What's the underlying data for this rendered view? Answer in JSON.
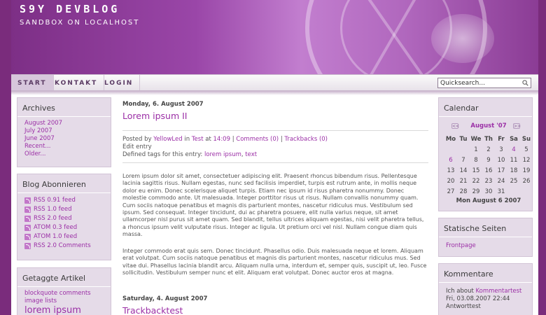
{
  "header": {
    "title": "S9Y DEVBLOG",
    "subtitle": "SANDBOX ON LOCALHOST"
  },
  "nav": {
    "items": [
      "START",
      "KONTAKT",
      "LOGIN"
    ],
    "search_value": "Quicksearch..."
  },
  "left_sidebar": {
    "archives": {
      "title": "Archives",
      "links": [
        "August 2007",
        "July 2007",
        "June 2007",
        "Recent...",
        "Older..."
      ]
    },
    "subscribe": {
      "title": "Blog Abonnieren",
      "feeds": [
        "RSS 0.91 feed",
        "RSS 1.0 feed",
        "RSS 2.0 feed",
        "ATOM 0.3 feed",
        "ATOM 1.0 feed",
        "RSS 2.0 Comments"
      ]
    },
    "tagged": {
      "title": "Getaggte Artikel",
      "links": [
        "blockquote comments",
        "image lists",
        "lorem ipsum"
      ]
    }
  },
  "posts": [
    {
      "date": "Monday, 6. August 2007",
      "title": "Lorem ipsum II",
      "meta": {
        "posted_by": "Posted by",
        "author": "YellowLed",
        "in": "in",
        "category": "Test",
        "at": "at",
        "time": "14:09",
        "comments": "Comments (0)",
        "trackbacks": "Trackbacks (0)",
        "edit": "Edit entry",
        "tags_label": "Defined tags for this entry:",
        "tag1": "lorem ipsum",
        "tag2": "text"
      },
      "body1": "Lorem ipsum dolor sit amet, consectetuer adipiscing elit. Praesent rhoncus bibendum risus. Pellentesque lacinia sagittis risus. Nullam egestas, nunc sed facilisis imperdiet, turpis est rutrum ante, in mollis neque dolor eu enim. Donec scelerisque aliquet turpis. Etiam nec ipsum id risus pharetra nonummy. Donec molestie commodo ante. Ut malesuada. Integer porttitor risus ut risus. Nullam convallis nonummy quam. Cum sociis natoque penatibus et magnis dis parturient montes, nascetur ridiculus mus. Vestibulum sed ipsum. Sed consequat. Integer tincidunt, dui ac pharetra posuere, elit nulla varius neque, sit amet ullamcorper nisl purus sit amet quam. Sed blandit, tellus ultrices aliquam egestas, nisi velit pharetra tellus, a rhoncus ipsum velit vulputate risus. Integer ac ligula. Ut pretium orci vel nisl. Nullam congue diam quis massa.",
      "body2": "Integer commodo erat quis sem. Donec tincidunt. Phasellus odio. Duis malesuada neque et lorem. Aliquam erat volutpat. Cum sociis natoque penatibus et magnis dis parturient montes, nascetur ridiculus mus. Sed vitae dui. Phasellus lacinia blandit arcu. Aliquam nulla urna, interdum et, semper quis, suscipit ut, leo. Fusce sollicitudin. Vestibulum semper nunc et elit. Aliquam erat volutpat. Donec auctor eros at magna."
    },
    {
      "date": "Saturday, 4. August 2007",
      "title": "Trackbacktest"
    }
  ],
  "right_sidebar": {
    "calendar": {
      "title": "Calendar",
      "month": "August '07",
      "prev": "<<",
      "next": ">>",
      "weekdays": [
        "Mo",
        "Tu",
        "We",
        "Th",
        "Fr",
        "Sa",
        "Su"
      ],
      "weeks": [
        [
          "",
          "",
          "1",
          "2",
          "3",
          "4",
          "5"
        ],
        [
          "6",
          "7",
          "8",
          "9",
          "10",
          "11",
          "12"
        ],
        [
          "13",
          "14",
          "15",
          "16",
          "17",
          "18",
          "19"
        ],
        [
          "20",
          "21",
          "22",
          "23",
          "24",
          "25",
          "26"
        ],
        [
          "27",
          "28",
          "29",
          "30",
          "31",
          "",
          ""
        ]
      ],
      "linked_days": [
        "4",
        "6"
      ],
      "footer": "Mon August 6 2007"
    },
    "static_pages": {
      "title": "Statische Seiten",
      "links": [
        "Frontpage"
      ]
    },
    "comments": {
      "title": "Kommentare",
      "author": "Ich about",
      "link": "Kommentartest",
      "date": "Fri, 03.08.2007 22:44",
      "text": "Antworttest"
    }
  },
  "colors": {
    "accent": "#9b2fa6",
    "box_bg": "#e5dbe8",
    "page_bg": "#7a2c7c"
  }
}
